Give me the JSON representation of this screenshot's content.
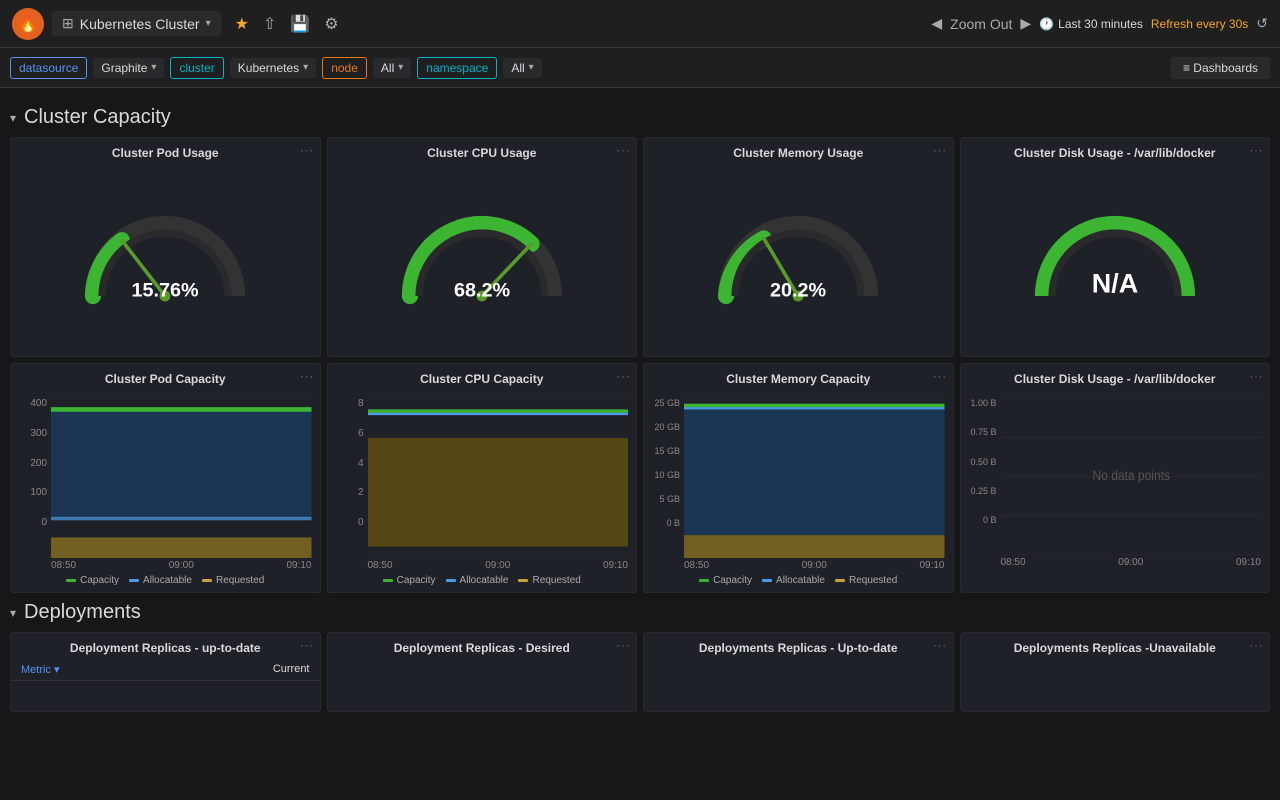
{
  "topnav": {
    "logo": "🔥",
    "title": "Kubernetes Cluster",
    "caret": "▾",
    "star_icon": "★",
    "share_icon": "⇧",
    "save_icon": "💾",
    "settings_icon": "⚙",
    "zoom_out": "Zoom Out",
    "time_range": "Last 30 minutes",
    "refresh_label": "Refresh every 30s",
    "refresh_icon": "↺"
  },
  "filterbar": {
    "datasource_label": "datasource",
    "graphite_label": "Graphite",
    "cluster_label": "cluster",
    "kubernetes_label": "Kubernetes",
    "node_label": "node",
    "all_label": "All",
    "namespace_label": "namespace",
    "all2_label": "All",
    "dashboards_label": "≡ Dashboards"
  },
  "cluster_capacity": {
    "section_title": "Cluster Capacity",
    "toggle": "▾",
    "gauges": [
      {
        "title": "Cluster Pod Usage",
        "value": "15.76%",
        "pct": 15.76,
        "color": "#3cb533"
      },
      {
        "title": "Cluster CPU Usage",
        "value": "68.2%",
        "pct": 68.2,
        "color": "#3cb533"
      },
      {
        "title": "Cluster Memory Usage",
        "value": "20.2%",
        "pct": 20.2,
        "color": "#3cb533"
      },
      {
        "title": "Cluster Disk Usage - /var/lib/docker",
        "value": "N/A",
        "pct": 85,
        "color": "#3cb533",
        "na": true
      }
    ],
    "charts": [
      {
        "title": "Cluster Pod Capacity",
        "y_labels": [
          "400",
          "300",
          "200",
          "100",
          "0"
        ],
        "x_labels": [
          "08:50",
          "09:00",
          "09:10"
        ],
        "legend": [
          {
            "label": "Capacity",
            "color": "#3cb533"
          },
          {
            "label": "Allocatable",
            "color": "#4c9be8"
          },
          {
            "label": "Requested",
            "color": "#c8a03c"
          }
        ],
        "area1_color": "#1a5c2e",
        "area2_color": "#1a3a5c",
        "line_y_pct": 0.13,
        "type": "area"
      },
      {
        "title": "Cluster CPU Capacity",
        "y_labels": [
          "8",
          "6",
          "4",
          "2",
          "0"
        ],
        "x_labels": [
          "08:50",
          "09:00",
          "09:10"
        ],
        "legend": [
          {
            "label": "Capacity",
            "color": "#3cb533"
          },
          {
            "label": "Allocatable",
            "color": "#4c9be8"
          },
          {
            "label": "Requested",
            "color": "#c8a03c"
          }
        ],
        "type": "area"
      },
      {
        "title": "Cluster Memory Capacity",
        "y_labels": [
          "25 GB",
          "20 GB",
          "15 GB",
          "10 GB",
          "5 GB",
          "0 B"
        ],
        "x_labels": [
          "08:50",
          "09:00",
          "09:10"
        ],
        "legend": [
          {
            "label": "Capacity",
            "color": "#3cb533"
          },
          {
            "label": "Allocatable",
            "color": "#4c9be8"
          },
          {
            "label": "Requested",
            "color": "#c8a03c"
          }
        ],
        "type": "area"
      },
      {
        "title": "Cluster Disk Usage - /var/lib/docker",
        "y_labels": [
          "1.00 B",
          "0.75 B",
          "0.50 B",
          "0.25 B",
          "0 B"
        ],
        "x_labels": [
          "08:50",
          "09:00",
          "09:10"
        ],
        "no_data": true,
        "no_data_text": "No data points"
      }
    ]
  },
  "deployments": {
    "section_title": "Deployments",
    "toggle": "▾",
    "panels": [
      {
        "title": "Deployment Replicas - up-to-date",
        "metric_label": "Metric",
        "current_label": "Current",
        "has_table": true
      },
      {
        "title": "Deployment Replicas - Desired",
        "has_table": false
      },
      {
        "title": "Deployments Replicas - Up-to-date",
        "has_table": false
      },
      {
        "title": "Deployments Replicas -Unavailable",
        "has_table": false
      }
    ]
  }
}
